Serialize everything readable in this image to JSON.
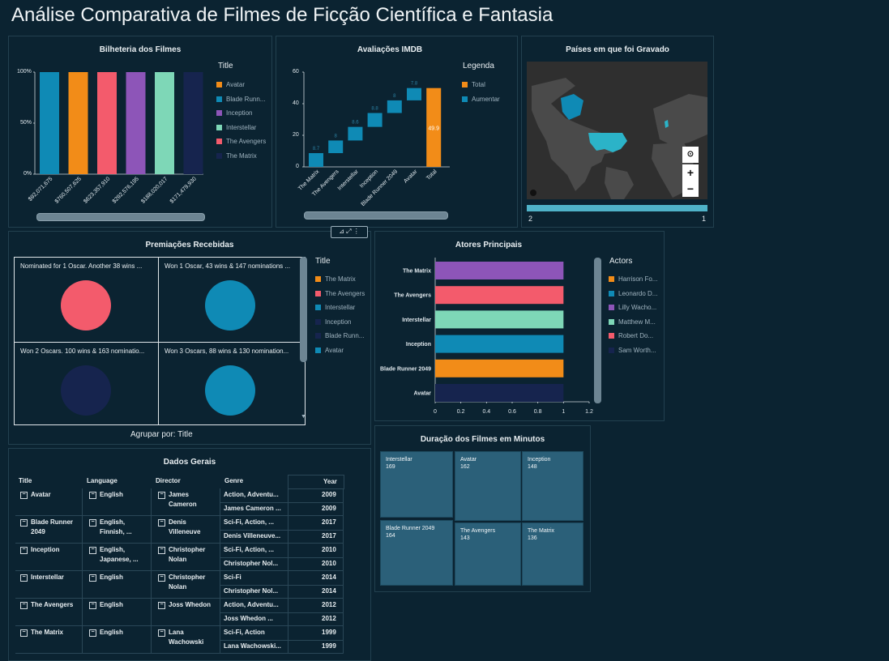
{
  "page": {
    "title": "Análise Comparativa de Filmes de Ficção Científica e Fantasia"
  },
  "colors": {
    "background": "#0b2331",
    "orange": "#f28c18",
    "blue": "#0f8ab5",
    "purple": "#8d55b8",
    "mint": "#7ed7b7",
    "red": "#f35b6c",
    "navy": "#16244e",
    "treemap": "#2b6079"
  },
  "box_office": {
    "title": "Bilheteria dos Filmes",
    "legend_title": "Title",
    "legend": [
      {
        "label": "Avatar",
        "color": "#f28c18"
      },
      {
        "label": "Blade Runn...",
        "color": "#0f8ab5"
      },
      {
        "label": "Inception",
        "color": "#8d55b8"
      },
      {
        "label": "Interstellar",
        "color": "#7ed7b7"
      },
      {
        "label": "The Avengers",
        "color": "#f35b6c"
      },
      {
        "label": "The Matrix",
        "color": "#16244e"
      }
    ],
    "y_ticks": [
      "100%",
      "50%",
      "0%"
    ],
    "x_ticks": [
      "$92,071,675",
      "$760,507,625",
      "$623,357,910",
      "$292,576,195",
      "$188,020,017",
      "$171,479,930"
    ]
  },
  "imdb": {
    "title": "Avaliações IMDB",
    "legend_title": "Legenda",
    "legend": [
      {
        "label": "Total",
        "color": "#f28c18"
      },
      {
        "label": "Aumentar",
        "color": "#0f8ab5"
      }
    ],
    "y_ticks": [
      "60",
      "40",
      "20",
      "0"
    ]
  },
  "map": {
    "title": "Países em que foi Gravado",
    "scale_min": "2",
    "scale_max": "1",
    "zoom_in": "+",
    "zoom_out": "−"
  },
  "awards": {
    "title": "Premiações Recebidas",
    "group_by": "Agrupar por: Title",
    "legend_title": "Title",
    "cells": [
      "Nominated for 1 Oscar. Another 38 wins ...",
      "Won 1 Oscar, 43 wins & 147 nominations ...",
      "Won 2 Oscars. 100 wins & 163 nominatio...",
      "Won 3 Oscars, 88 wins & 130 nomination..."
    ],
    "legend": [
      {
        "label": "The Matrix",
        "color": "#f28c18"
      },
      {
        "label": "The Avengers",
        "color": "#f35b6c"
      },
      {
        "label": "Interstellar",
        "color": "#0f8ab5"
      },
      {
        "label": "Inception",
        "color": "#16244e"
      },
      {
        "label": "Blade Runn...",
        "color": "#16244e"
      },
      {
        "label": "Avatar",
        "color": "#0f8ab5"
      }
    ]
  },
  "actors": {
    "title": "Atores Principais",
    "legend_title": "Actors",
    "legend": [
      {
        "label": "Harrison Fo...",
        "color": "#f28c18"
      },
      {
        "label": "Leonardo D...",
        "color": "#0f8ab5"
      },
      {
        "label": "Lilly Wacho...",
        "color": "#8d55b8"
      },
      {
        "label": "Matthew M...",
        "color": "#7ed7b7"
      },
      {
        "label": "Robert Do...",
        "color": "#f35b6c"
      },
      {
        "label": "Sam Worth...",
        "color": "#16244e"
      }
    ],
    "x_ticks": [
      "0",
      "0.2",
      "0.4",
      "0.6",
      "0.8",
      "1",
      "1.2"
    ]
  },
  "data_table": {
    "title": "Dados Gerais",
    "headers": {
      "title": "Title",
      "language": "Language",
      "director": "Director",
      "genre": "Genre",
      "year": "Year"
    },
    "rows": [
      {
        "title": "Avatar",
        "language": "English",
        "director": "James Cameron",
        "genre1": "Action, Adventu...",
        "genre2": "James Cameron ...",
        "year1": "2009",
        "year2": "2009"
      },
      {
        "title": "Blade Runner 2049",
        "language": "English, Finnish, ...",
        "director": "Denis Villeneuve",
        "genre1": "Sci-Fi, Action, ...",
        "genre2": "Denis Villeneuve...",
        "year1": "2017",
        "year2": "2017"
      },
      {
        "title": "Inception",
        "language": "English, Japanese, ...",
        "director": "Christopher Nolan",
        "genre1": "Sci-Fi, Action, ...",
        "genre2": "Christopher Nol...",
        "year1": "2010",
        "year2": "2010"
      },
      {
        "title": "Interstellar",
        "language": "English",
        "director": "Christopher Nolan",
        "genre1": "Sci-Fi",
        "genre2": "Christopher Nol...",
        "year1": "2014",
        "year2": "2014"
      },
      {
        "title": "The Avengers",
        "language": "English",
        "director": "Joss Whedon",
        "genre1": "Action, Adventu...",
        "genre2": "Joss Whedon ...",
        "year1": "2012",
        "year2": "2012"
      },
      {
        "title": "The Matrix",
        "language": "English",
        "director": "Lana Wachowski",
        "genre1": "Sci-Fi, Action",
        "genre2": "Lana Wachowski...",
        "year1": "1999",
        "year2": "1999"
      }
    ]
  },
  "duration": {
    "title": "Duração dos Filmes em Minutos"
  },
  "chart_data": [
    {
      "type": "bar",
      "title": "Bilheteria dos Filmes",
      "categories": [
        "$92,071,675",
        "$760,507,625",
        "$623,357,910",
        "$292,576,195",
        "$188,020,017",
        "$171,479,930"
      ],
      "series": [
        {
          "name": "Blade Runn...",
          "values": [
            1,
            0,
            0,
            0,
            0,
            0
          ]
        },
        {
          "name": "Avatar",
          "values": [
            0,
            1,
            0,
            0,
            0,
            0
          ]
        },
        {
          "name": "The Avengers",
          "values": [
            0,
            0,
            1,
            0,
            0,
            0
          ]
        },
        {
          "name": "Inception",
          "values": [
            0,
            0,
            0,
            1,
            0,
            0
          ]
        },
        {
          "name": "Interstellar",
          "values": [
            0,
            0,
            0,
            0,
            1,
            0
          ]
        },
        {
          "name": "The Matrix",
          "values": [
            0,
            0,
            0,
            0,
            0,
            1
          ]
        }
      ],
      "ylim": [
        0,
        1
      ],
      "y_ticks": [
        "100%",
        "50%",
        "0%"
      ],
      "legend": "right"
    },
    {
      "type": "bar",
      "title": "Avaliações IMDB",
      "subtype": "waterfall",
      "categories": [
        "The Matrix",
        "The Avengers",
        "Interstellar",
        "Inception",
        "Blade Runner 2049",
        "Avatar",
        "Total"
      ],
      "values": [
        8.7,
        8,
        8.6,
        8.8,
        8,
        7.8,
        49.9
      ],
      "data_labels": [
        "8.7",
        "8",
        "8.6",
        "8.8",
        "8",
        "7.8",
        "49.9"
      ],
      "ylim": [
        0,
        60
      ],
      "legend": "right"
    },
    {
      "type": "pie",
      "title": "Premiações Recebidas",
      "categories": [
        "Nominated for 1 Oscar. Another 38 wins ...",
        "Won 1 Oscar, 43 wins & 147 nominations ...",
        "Won 2 Oscars. 100 wins & 163 nominatio...",
        "Won 3 Oscars, 88 wins & 130 nomination..."
      ],
      "values": [
        1,
        1,
        1,
        1
      ],
      "colors": [
        "#f35b6c",
        "#0f8ab5",
        "#16244e",
        "#0f8ab5"
      ]
    },
    {
      "type": "bar",
      "orientation": "horizontal",
      "title": "Atores Principais",
      "categories": [
        "The Matrix",
        "The Avengers",
        "Interstellar",
        "Inception",
        "Blade Runner 2049",
        "Avatar"
      ],
      "values": [
        1,
        1,
        1,
        1,
        1,
        1
      ],
      "colors": [
        "#8d55b8",
        "#f35b6c",
        "#7ed7b7",
        "#0f8ab5",
        "#f28c18",
        "#16244e"
      ],
      "xlim": [
        0,
        1.2
      ],
      "legend": "right"
    },
    {
      "type": "heatmap",
      "subtype": "treemap",
      "title": "Duração dos Filmes em Minutos",
      "categories": [
        "Interstellar",
        "Avatar",
        "Inception",
        "Blade Runner 2049",
        "The Avengers",
        "The Matrix"
      ],
      "values": [
        169,
        162,
        148,
        164,
        143,
        136
      ]
    }
  ]
}
